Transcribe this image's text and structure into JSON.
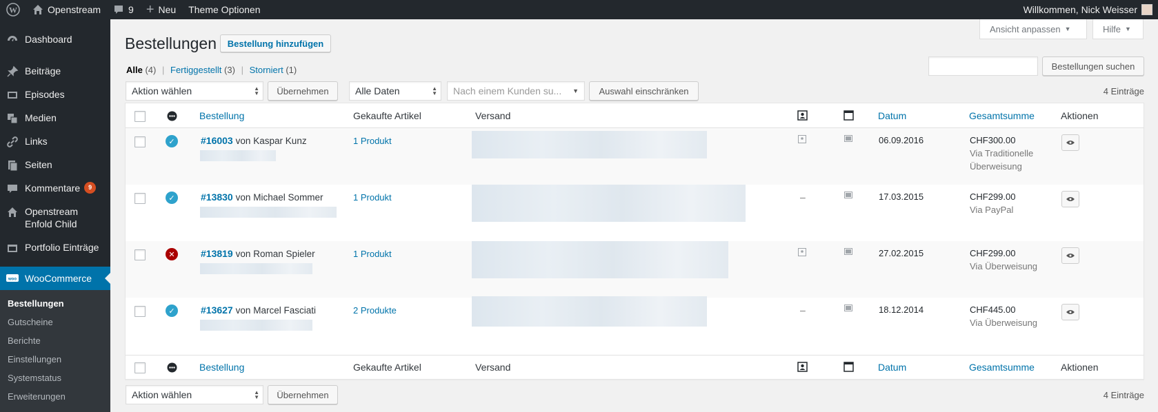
{
  "adminbar": {
    "site_name": "Openstream",
    "comments_count": "9",
    "new_label": "Neu",
    "theme_options": "Theme Optionen",
    "greeting": "Willkommen, Nick Weisser"
  },
  "sidebar": {
    "items": [
      {
        "label": "Dashboard",
        "icon": "dashboard-icon"
      },
      {
        "label": "Beiträge",
        "icon": "pin-icon"
      },
      {
        "label": "Episodes",
        "icon": "media-icon"
      },
      {
        "label": "Medien",
        "icon": "media-library-icon"
      },
      {
        "label": "Links",
        "icon": "link-icon"
      },
      {
        "label": "Seiten",
        "icon": "pages-icon"
      },
      {
        "label": "Kommentare",
        "icon": "comment-icon",
        "badge": "9"
      },
      {
        "label": "Openstream Enfold Child",
        "icon": "home-icon"
      },
      {
        "label": "Portfolio Einträge",
        "icon": "portfolio-icon"
      },
      {
        "label": "WooCommerce",
        "icon": "woocommerce-icon"
      }
    ],
    "submenu": [
      "Bestellungen",
      "Gutscheine",
      "Berichte",
      "Einstellungen",
      "Systemstatus",
      "Erweiterungen"
    ]
  },
  "screen_options": "Ansicht anpassen",
  "help": "Hilfe",
  "page_title": "Bestellungen",
  "add_button": "Bestellung hinzufügen",
  "filters": {
    "all": "Alle",
    "all_count": "(4)",
    "completed": "Fertiggestellt",
    "completed_count": "(3)",
    "cancelled": "Storniert",
    "cancelled_count": "(1)"
  },
  "search_button": "Bestellungen suchen",
  "search_value": "",
  "bulk_action": "Aktion wählen",
  "apply": "Übernehmen",
  "dates": "Alle Daten",
  "customer_placeholder": "Nach einem Kunden su...",
  "filter_button": "Auswahl einschränken",
  "items_count": "4 Einträge",
  "columns": {
    "order": "Bestellung",
    "items": "Gekaufte Artikel",
    "shipping": "Versand",
    "date": "Datum",
    "total": "Gesamtsumme",
    "actions": "Aktionen"
  },
  "orders": [
    {
      "number": "#16003",
      "by": "von",
      "customer": "Kaspar Kunz",
      "customer_link": false,
      "items": "1 Produkt",
      "col_a": "",
      "date": "06.09.2016",
      "total": "CHF300.00",
      "via1": "Via Traditionelle",
      "via2": "Überweisung",
      "status": "completed"
    },
    {
      "number": "#13830",
      "by": "von",
      "customer": "Michael Sommer",
      "customer_link": true,
      "items": "1 Produkt",
      "col_a": "–",
      "date": "17.03.2015",
      "total": "CHF299.00",
      "via1": "Via PayPal",
      "via2": "",
      "status": "completed"
    },
    {
      "number": "#13819",
      "by": "von",
      "customer": "Roman Spieler",
      "customer_link": false,
      "items": "1 Produkt",
      "col_a": "",
      "date": "27.02.2015",
      "total": "CHF299.00",
      "via1": "Via Überweisung",
      "via2": "",
      "status": "cancelled"
    },
    {
      "number": "#13627",
      "by": "von",
      "customer": "Marcel Fasciati",
      "customer_link": false,
      "items": "2 Produkte",
      "col_a": "–",
      "date": "18.12.2014",
      "total": "CHF445.00",
      "via1": "Via Überweisung",
      "via2": "",
      "status": "completed"
    }
  ],
  "colors": {
    "accent": "#0073aa",
    "sidebar": "#23282d",
    "completed": "#2ea2cc",
    "cancelled": "#a00"
  }
}
